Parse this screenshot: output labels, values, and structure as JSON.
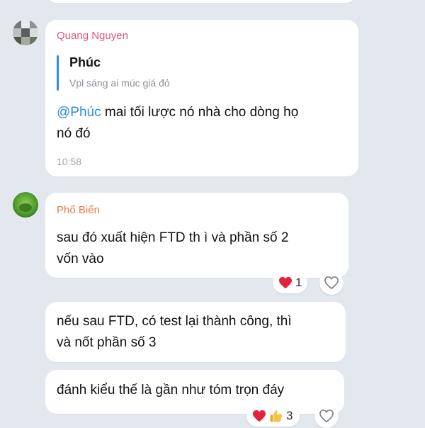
{
  "colors": {
    "background": "#e3e8ef",
    "bubble": "#ffffff",
    "sender_quang": "#e0547a",
    "sender_pho": "#e8784a",
    "mention": "#2b8de8",
    "quote_bar": "#2b8de8",
    "heart": "#e8213a"
  },
  "messages": [
    {
      "sender": "Quang Nguyen",
      "quote": {
        "author": "Phúc",
        "text": "Vpl sáng ai múc giá đỏ"
      },
      "mention": "@Phúc",
      "line1_rest": " mai tối lược nó nhà cho dòng họ",
      "line2": "nó đó",
      "time": "10:58"
    },
    {
      "sender": "Phổ Biển",
      "lines": [
        "sau đó xuất hiện FTD th ì và phần số 2",
        "vốn vào"
      ],
      "reactions": [
        {
          "icon": "heart-icon",
          "count": "1"
        }
      ]
    },
    {
      "lines": [
        "nếu sau FTD, có test lại thành công, thì",
        "và nốt phần số 3"
      ]
    },
    {
      "lines": [
        "đánh kiểu thế là gần như tóm trọn đáy"
      ],
      "reactions": [
        {
          "icon": "heart-icon"
        },
        {
          "icon": "thumbs-up-icon",
          "count": "3"
        }
      ]
    }
  ]
}
